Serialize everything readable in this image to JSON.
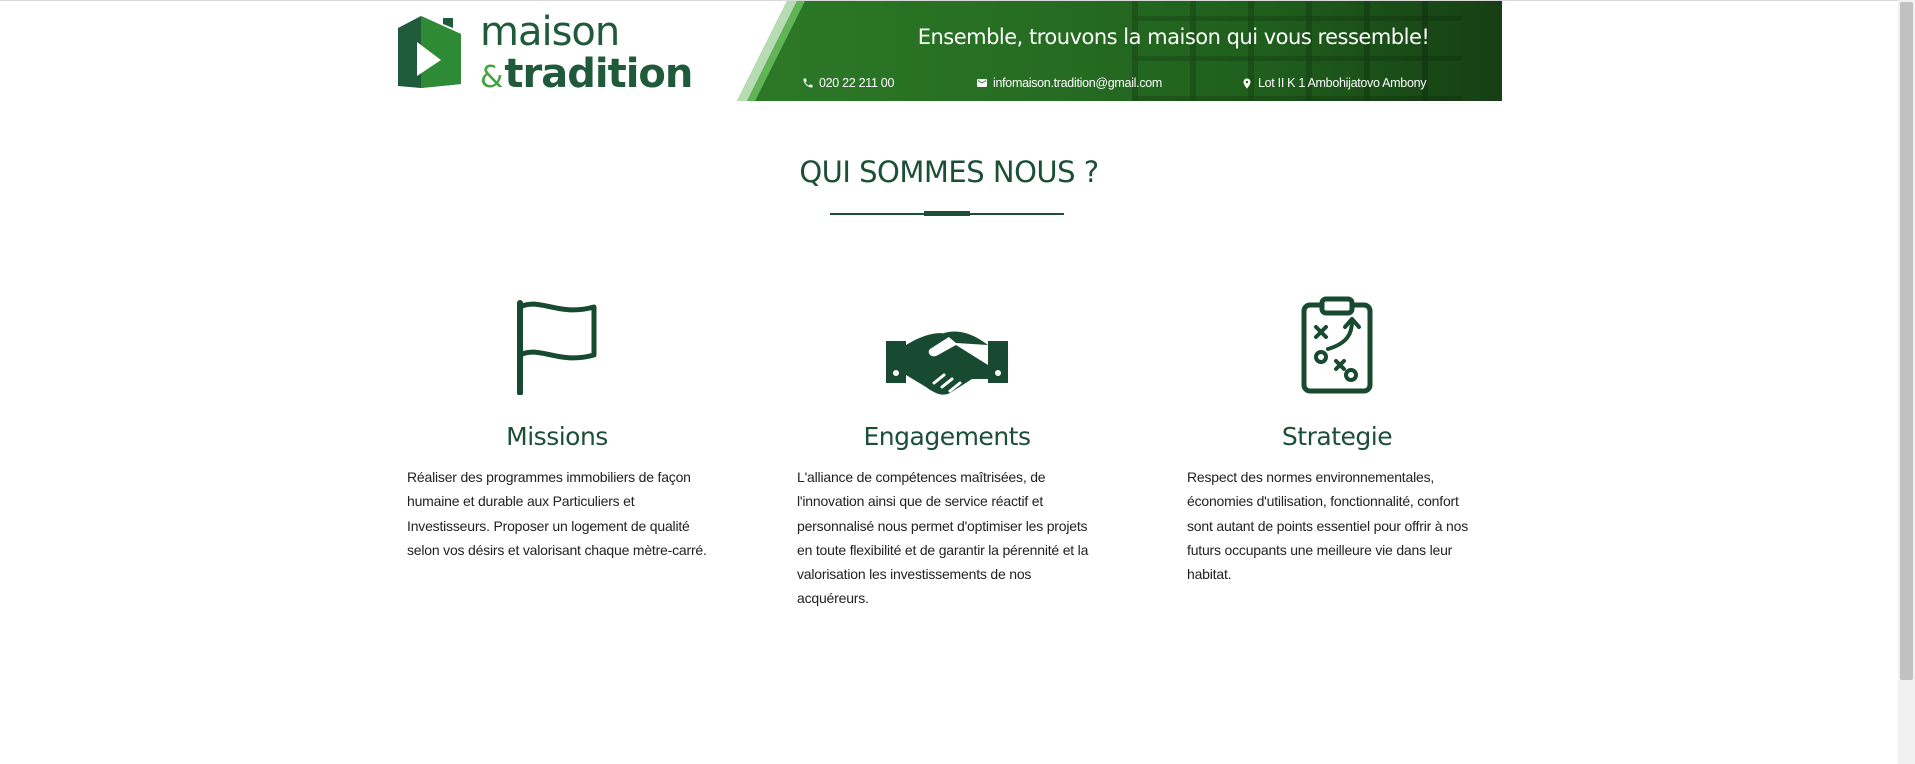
{
  "header": {
    "logo": {
      "line1": "maison",
      "amp": "&",
      "line2": "tradition"
    },
    "tagline": "Ensemble, trouvons la maison qui vous ressemble!",
    "contacts": {
      "phone": {
        "icon": "phone-icon",
        "text": "020 22 211 00"
      },
      "email": {
        "icon": "mail-icon",
        "text": "infomaison.tradition@gmail.com"
      },
      "address": {
        "icon": "location-pin-icon",
        "text": "Lot II K 1 Ambohijatovo Ambony"
      }
    }
  },
  "section": {
    "title": "QUI SOMMES NOUS ?",
    "columns": [
      {
        "icon": "flag-icon",
        "title": "Missions",
        "text": "Réaliser des programmes immobiliers de façon humaine et durable aux Particuliers et Investisseurs. Proposer un logement de qualité selon vos désirs et valorisant chaque mètre-carré."
      },
      {
        "icon": "handshake-icon",
        "title": "Engagements",
        "text": "L'alliance de compétences maîtrisées, de l'innovation ainsi que de service réactif et personnalisé nous permet d'optimiser les projets en toute flexibilité et de garantir la pérennité et la valorisation les investissements de nos acquéreurs."
      },
      {
        "icon": "strategy-clipboard-icon",
        "title": "Strategie",
        "text": "Respect des normes environnementales, économies d'utilisation, fonctionnalité, confort sont autant de points essentiel pour offrir à nos futurs occupants une meilleure vie dans leur habitat."
      }
    ]
  },
  "colors": {
    "brand_dark": "#1b4f36",
    "brand_green": "#45a340",
    "banner_green": "#2d7a28"
  }
}
